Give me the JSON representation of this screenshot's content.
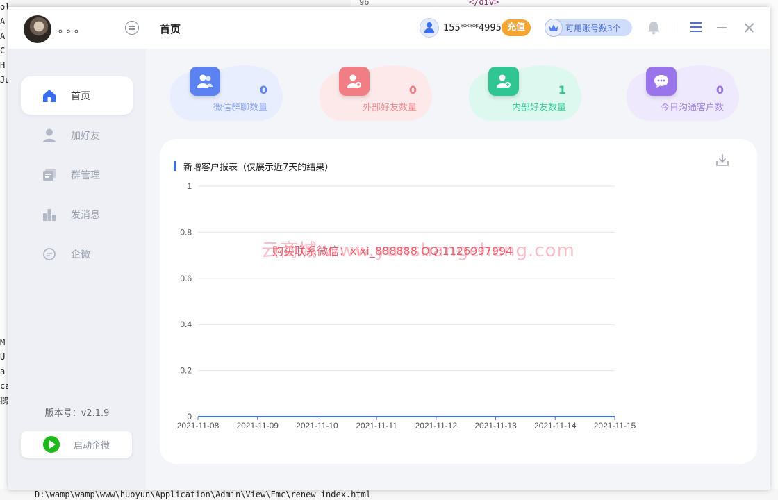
{
  "background": {
    "left_fragments": [
      "olication",
      "A",
      "A",
      "C",
      "H",
      "Ju",
      "",
      "",
      "",
      "",
      "",
      "",
      "",
      "",
      "",
      "",
      "",
      "",
      "",
      "",
      "",
      "",
      "",
      "M",
      "U",
      "a",
      "ca",
      "鹅",
      ""
    ],
    "bottom_path": "D:\\wamp\\wamp\\www\\huoyun\\Application\\Admin\\View\\Fmc\\renew_index.html",
    "top_code": "</div>",
    "top_line_no": "96"
  },
  "profile": {
    "username": "。。。"
  },
  "nav": {
    "items": [
      {
        "label": "首页",
        "icon": "home-icon",
        "active": true
      },
      {
        "label": "加好友",
        "icon": "user-icon",
        "active": false
      },
      {
        "label": "群管理",
        "icon": "group-icon",
        "active": false
      },
      {
        "label": "发消息",
        "icon": "bar-chart-icon",
        "active": false
      },
      {
        "label": "企微",
        "icon": "chat-icon",
        "active": false
      }
    ]
  },
  "version": "版本号：v2.1.9",
  "start_button": "启动企微",
  "header": {
    "title": "首页",
    "phone": "155****4995",
    "recharge": "充值",
    "accounts": "可用账号数3个"
  },
  "stats": [
    {
      "label": "微信群聊数量",
      "value": "0",
      "color": "#5b82f0",
      "text_color": "#8ea7f0",
      "bg": "#e8eefd"
    },
    {
      "label": "外部好友数量",
      "value": "0",
      "color": "#f07e84",
      "text_color": "#f08c91",
      "bg": "#fde9ea"
    },
    {
      "label": "内部好友数量",
      "value": "1",
      "color": "#2fc694",
      "text_color": "#3cc99c",
      "bg": "#ddf8ee"
    },
    {
      "label": "今日沟通客户数",
      "value": "0",
      "color": "#9a74ea",
      "text_color": "#a386e6",
      "bg": "#efe9fd"
    }
  ],
  "chart": {
    "title": "新增客户报表（仅展示近7天的结果）",
    "watermark_back": "云商城 www.yunshangcheng.com",
    "watermark_front": "购买联系微信：xixi_888888  QQ:1126997994"
  },
  "chart_data": {
    "type": "line",
    "categories": [
      "2021-11-08",
      "2021-11-09",
      "2021-11-10",
      "2021-11-11",
      "2021-11-12",
      "2021-11-13",
      "2021-11-14",
      "2021-11-15"
    ],
    "series": [
      {
        "values": [
          0,
          0,
          0,
          0,
          0,
          0,
          0,
          0
        ]
      }
    ],
    "yticks": [
      "0",
      "0.2",
      "0.4",
      "0.6",
      "0.8",
      "1"
    ],
    "ylim": [
      0,
      1
    ],
    "grid": true,
    "line_color": "#3b6ff0"
  }
}
